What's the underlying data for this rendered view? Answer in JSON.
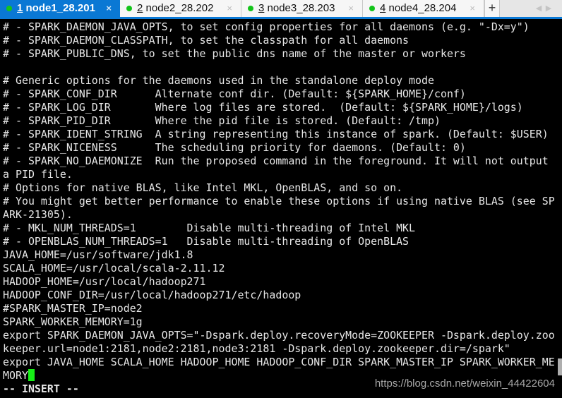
{
  "tabs": [
    {
      "number": "1",
      "label": " node1_28.201",
      "close": "×",
      "active": true,
      "status_color": "#13c41a"
    },
    {
      "number": "2",
      "label": " node2_28.202",
      "close": "×",
      "active": false,
      "status_color": "#13c41a"
    },
    {
      "number": "3",
      "label": " node3_28.203",
      "close": "×",
      "active": false,
      "status_color": "#13c41a"
    },
    {
      "number": "4",
      "label": " node4_28.204",
      "close": "×",
      "active": false,
      "status_color": "#13c41a"
    }
  ],
  "add_tab_label": "+",
  "scroll_left": "◀",
  "scroll_right": "▶",
  "terminal": {
    "lines": [
      "# - SPARK_DAEMON_JAVA_OPTS, to set config properties for all daemons (e.g. \"-Dx=y\")",
      "# - SPARK_DAEMON_CLASSPATH, to set the classpath for all daemons",
      "# - SPARK_PUBLIC_DNS, to set the public dns name of the master or workers",
      "",
      "# Generic options for the daemons used in the standalone deploy mode",
      "# - SPARK_CONF_DIR      Alternate conf dir. (Default: ${SPARK_HOME}/conf)",
      "# - SPARK_LOG_DIR       Where log files are stored.  (Default: ${SPARK_HOME}/logs)",
      "# - SPARK_PID_DIR       Where the pid file is stored. (Default: /tmp)",
      "# - SPARK_IDENT_STRING  A string representing this instance of spark. (Default: $USER)",
      "# - SPARK_NICENESS      The scheduling priority for daemons. (Default: 0)",
      "# - SPARK_NO_DAEMONIZE  Run the proposed command in the foreground. It will not output",
      "a PID file.",
      "# Options for native BLAS, like Intel MKL, OpenBLAS, and so on.",
      "# You might get better performance to enable these options if using native BLAS (see SP",
      "ARK-21305).",
      "# - MKL_NUM_THREADS=1        Disable multi-threading of Intel MKL",
      "# - OPENBLAS_NUM_THREADS=1   Disable multi-threading of OpenBLAS",
      "JAVA_HOME=/usr/software/jdk1.8",
      "SCALA_HOME=/usr/local/scala-2.11.12",
      "HADOOP_HOME=/usr/local/hadoop271",
      "HADOOP_CONF_DIR=/usr/local/hadoop271/etc/hadoop",
      "#SPARK_MASTER_IP=node2",
      "SPARK_WORKER_MEMORY=1g",
      "export SPARK_DAEMON_JAVA_OPTS=\"-Dspark.deploy.recoveryMode=ZOOKEEPER -Dspark.deploy.zoo",
      "keeper.url=node1:2181,node2:2181,node3:2181 -Dspark.deploy.zookeeper.dir=/spark\"",
      "export JAVA_HOME SCALA_HOME HADOOP_HOME HADOOP_CONF_DIR SPARK_MASTER_IP SPARK_WORKER_ME",
      "MORY"
    ],
    "mode_line": "-- INSERT --",
    "cursor_color": "#16f016"
  },
  "watermark": "https://blog.csdn.net/weixin_44422604"
}
